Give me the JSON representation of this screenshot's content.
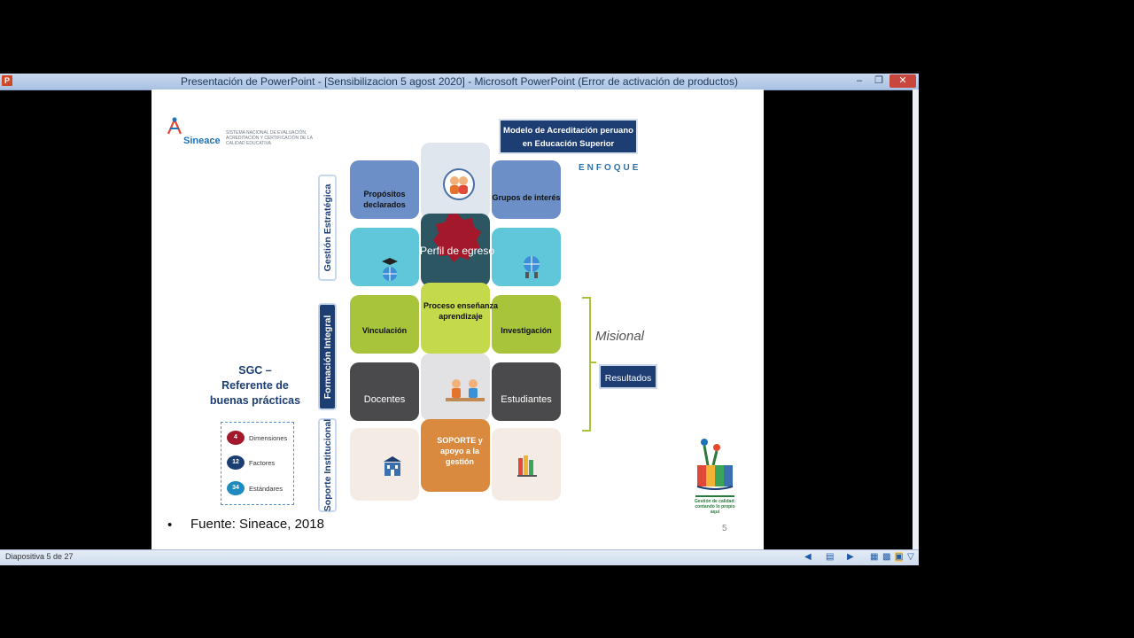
{
  "window": {
    "title": "Presentación de PowerPoint - [Sensibilizacion 5 agost 2020] - Microsoft PowerPoint (Error de activación de productos)",
    "app_icon_letter": "P",
    "controls": {
      "minimize": "–",
      "maximize": "❐",
      "close": "✕"
    }
  },
  "status": {
    "slide_indicator": "Diapositiva 5 de 27"
  },
  "slide": {
    "logo": {
      "name": "Sineace",
      "subtitle": "SISTEMA NACIONAL DE EVALUACIÓN, ACREDITACIÓN Y CERTIFICACIÓN DE LA CALIDAD EDUCATIVA"
    },
    "model_title": "Modelo de Acreditación peruano en Educación Superior",
    "enfoque": "ENFOQUE",
    "vertical_labels": [
      "Gestión Estratégica",
      "Formación Integral",
      "Soporte Institucional"
    ],
    "sgc": {
      "line1": "SGC –",
      "line2": "Referente de",
      "line3": "buenas prácticas"
    },
    "legend": [
      {
        "num": "4",
        "label": "Dimensiones",
        "color": "#a3182a"
      },
      {
        "num": "12",
        "label": "Factores",
        "color": "#1d3e73"
      },
      {
        "num": "34",
        "label": "Estándares",
        "color": "#1f8ac0"
      }
    ],
    "puzzle": {
      "propositos": "Propósitos declarados",
      "grupos": "Grupos de interés",
      "perfil": "Perfil de egreso",
      "vinculacion": "Vinculación",
      "proceso": "Proceso enseñanza aprendizaje",
      "investigacion": "Investigación",
      "docentes": "Docentes",
      "estudiantes": "Estudiantes",
      "soporte": "SOPORTE y apoyo a la gestión"
    },
    "misional": "Misional",
    "resultados": "Resultados",
    "bullet": "•",
    "fuente": "Fuente: Sineace, 2018",
    "slide_number": "5",
    "gc_logo_text": "Gestión de calidad: contando lo propio aquí"
  }
}
